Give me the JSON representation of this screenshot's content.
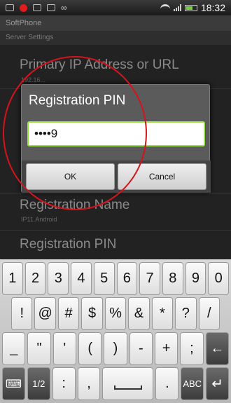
{
  "status": {
    "time": "18:32"
  },
  "app": {
    "title": "SoftPhone",
    "section": "Server Settings"
  },
  "prefs": [
    {
      "title": "Primary IP Address or URL",
      "summary": "192.16..."
    },
    {
      "title": "Registration Name",
      "summary": "IP11.Android"
    },
    {
      "title": "Registration PIN",
      "summary": ""
    }
  ],
  "dialog": {
    "title": "Registration PIN",
    "value": "••••9",
    "ok": "OK",
    "cancel": "Cancel"
  },
  "keyboard": {
    "row1": [
      "1",
      "2",
      "3",
      "4",
      "5",
      "6",
      "7",
      "8",
      "9",
      "0"
    ],
    "row2": [
      "!",
      "@",
      "#",
      "$",
      "%",
      "&",
      "*",
      "?",
      "/"
    ],
    "row3": [
      "_",
      "\"",
      "'",
      "(",
      ")",
      "-",
      "+",
      ";"
    ],
    "row4": {
      "page": "1/2",
      "k1": ":",
      "k2": ",",
      "k3": ".",
      "abc": "ABC"
    }
  },
  "colors": {
    "accent": "#9be04a",
    "annotation": "#d4141c"
  }
}
